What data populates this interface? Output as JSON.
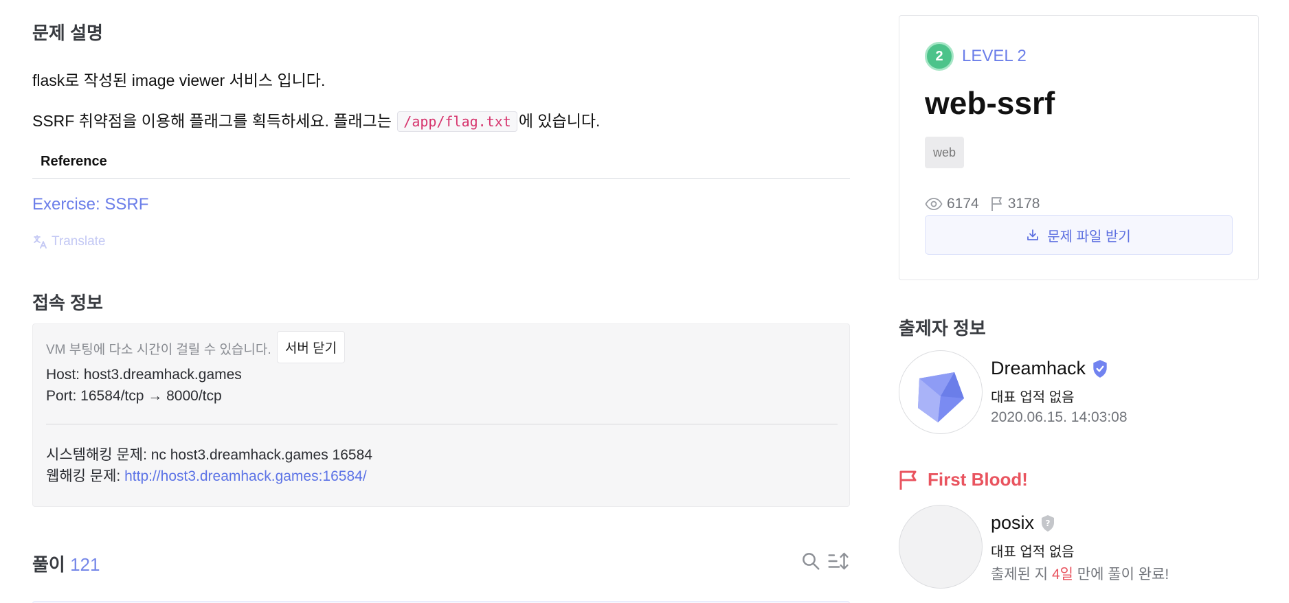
{
  "description": {
    "section_title": "문제 설명",
    "line1": "flask로 작성된 image viewer 서비스 입니다.",
    "line2_before": "SSRF 취약점을 이용해 플래그를 획득하세요. 플래그는 ",
    "line2_code": "/app/flag.txt",
    "line2_after": "에 있습니다.",
    "reference_header": "Reference",
    "reference_link": "Exercise: SSRF",
    "translate_label": "Translate"
  },
  "connection": {
    "section_title": "접속 정보",
    "note": "VM 부팅에 다소 시간이 걸릴 수 있습니다.",
    "server_close_button": "서버 닫기",
    "host": "Host: host3.dreamhack.games",
    "port": "Port:  16584/tcp → 8000/tcp",
    "system_hacking": "시스템해킹 문제: nc host3.dreamhack.games 16584",
    "web_hacking_prefix": "웹해킹 문제: ",
    "web_hacking_link": "http://host3.dreamhack.games:16584/"
  },
  "solutions": {
    "title": "풀이",
    "count": "121"
  },
  "challenge": {
    "level_number": "2",
    "level_label": "LEVEL 2",
    "name": "web-ssrf",
    "tag": "web",
    "views": "6174",
    "solves": "3178",
    "download_button": "문제 파일 받기"
  },
  "author": {
    "section_title": "출제자 정보",
    "name": "Dreamhack",
    "achievement": "대표 업적 없음",
    "date": "2020.06.15. 14:03:08"
  },
  "first_blood": {
    "title": "First Blood!",
    "name": "posix",
    "achievement": "대표 업적 없음",
    "solved_prefix": "출제된 지 ",
    "solved_days": "4일",
    "solved_suffix": " 만에 풀이 완료!"
  },
  "colors": {
    "accent": "#6b7ee9",
    "level_green": "#4cc38a",
    "first_blood_red": "#e9545f",
    "code_pink": "#d6336c"
  }
}
